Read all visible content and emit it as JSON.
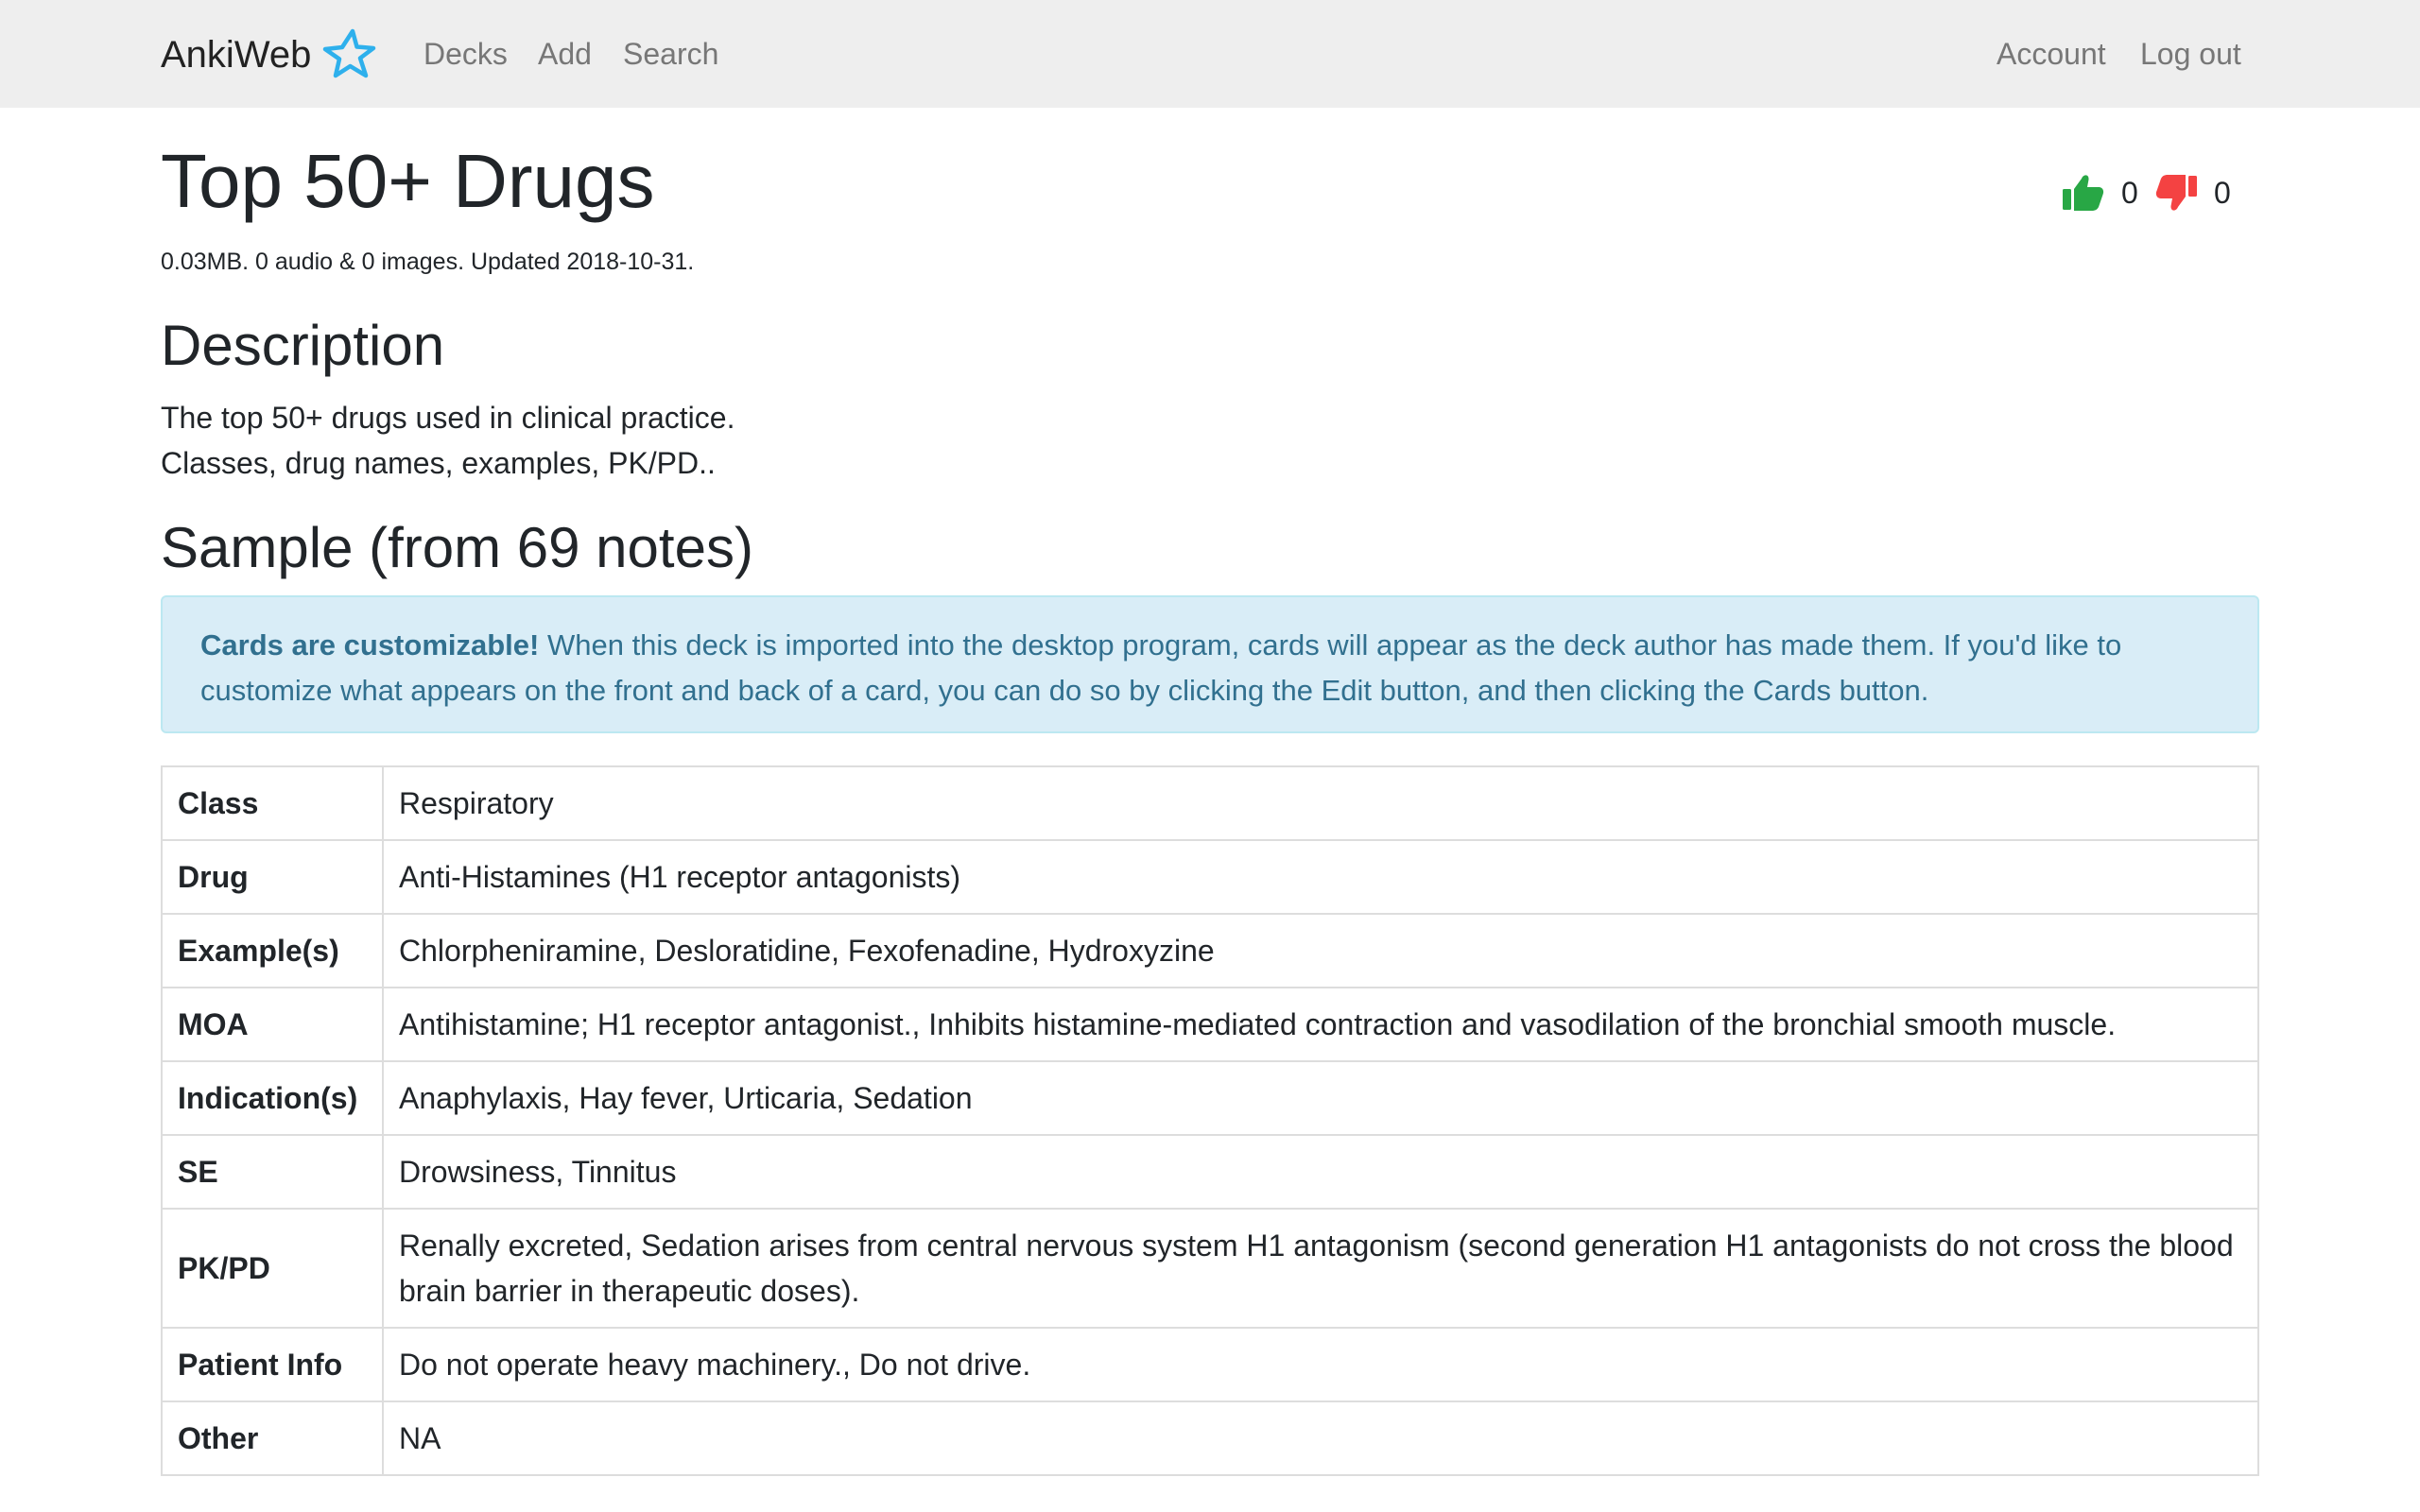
{
  "navbar": {
    "brand": "AnkiWeb",
    "links": [
      "Decks",
      "Add",
      "Search"
    ],
    "account": "Account",
    "logout": "Log out"
  },
  "deck": {
    "title": "Top 50+ Drugs",
    "meta": "0.03MB. 0 audio & 0 images. Updated 2018-10-31.",
    "thumbs_up": "0",
    "thumbs_down": "0"
  },
  "description": {
    "heading": "Description",
    "lines": [
      "The top 50+ drugs used in clinical practice.",
      "Classes, drug names, examples, PK/PD.."
    ]
  },
  "sample": {
    "heading": "Sample (from 69 notes)",
    "alert_strong": "Cards are customizable!",
    "alert_text": " When this deck is imported into the desktop program, cards will appear as the deck author has made them. If you'd like to customize what appears on the front and back of a card, you can do so by clicking the Edit button, and then clicking the Cards button.",
    "rows": [
      {
        "key": "Class",
        "value": "Respiratory"
      },
      {
        "key": "Drug",
        "value": "Anti-Histamines (H1 receptor antagonists)"
      },
      {
        "key": "Example(s)",
        "value": "Chlorpheniramine, Desloratidine, Fexofenadine, Hydroxyzine"
      },
      {
        "key": "MOA",
        "value": "Antihistamine; H1 receptor antagonist., Inhibits histamine-mediated contraction and vasodilation of the bronchial smooth muscle."
      },
      {
        "key": "Indication(s)",
        "value": "Anaphylaxis, Hay fever, Urticaria, Sedation"
      },
      {
        "key": "SE",
        "value": "Drowsiness, Tinnitus"
      },
      {
        "key": "PK/PD",
        "value": "Renally excreted, Sedation arises from central nervous system H1 antagonism (second generation H1 antagonists do not cross the blood brain barrier in therapeutic doses)."
      },
      {
        "key": "Patient Info",
        "value": "Do not operate heavy machinery., Do not drive."
      },
      {
        "key": "Other",
        "value": "NA"
      }
    ]
  },
  "colors": {
    "navbar_bg": "#eeeeee",
    "brand_star": "#2eb0ec",
    "thumbs_up": "#28a745",
    "thumbs_down": "#f44242",
    "alert_bg": "#d9edf7",
    "alert_text": "#31708f"
  },
  "icons": {
    "brand": "star-icon",
    "rating_up": "thumbs-up-icon",
    "rating_down": "thumbs-down-icon"
  }
}
